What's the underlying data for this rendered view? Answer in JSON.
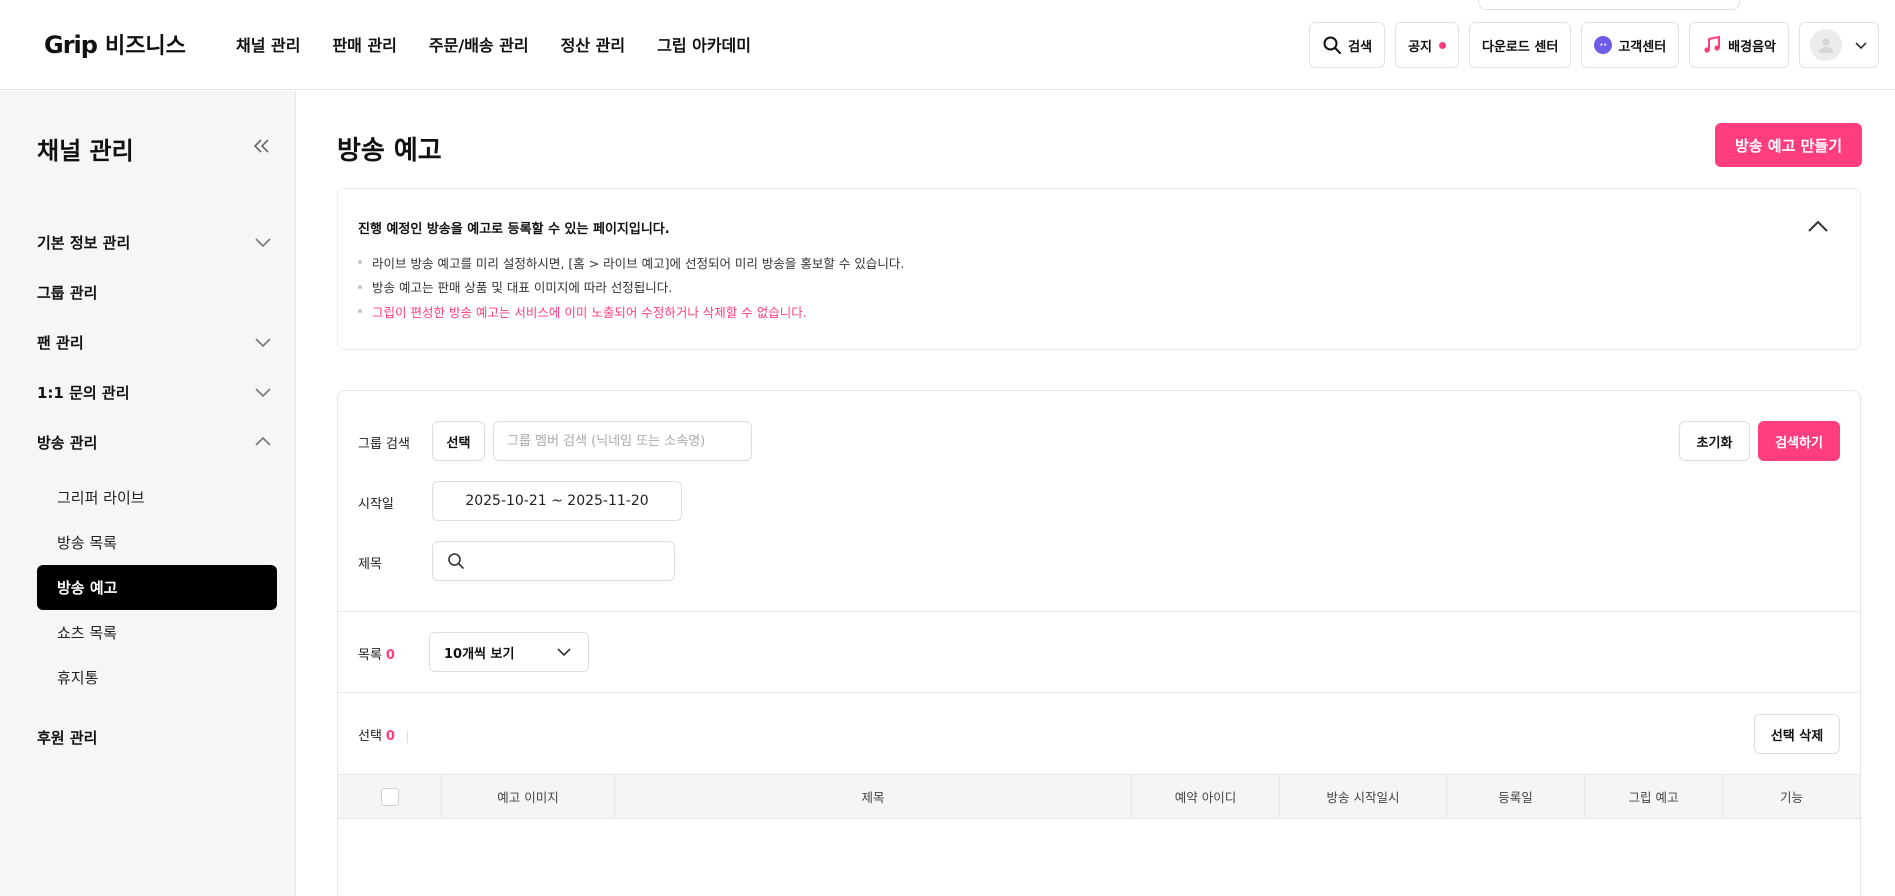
{
  "header": {
    "brand": "Grip",
    "brand_suffix": "비즈니스",
    "nav": [
      "채널 관리",
      "판매 관리",
      "주문/배송 관리",
      "정산 관리",
      "그립 아카데미"
    ],
    "search_label": "검색",
    "notice_label": "공지",
    "download_label": "다운로드 센터",
    "support_label": "고객센터",
    "bgm_label": "배경음악",
    "accent_color": "#ff3d7f"
  },
  "sidebar": {
    "title": "채널 관리",
    "items": {
      "basic": "기본 정보 관리",
      "group": "그룹 관리",
      "fan": "팬 관리",
      "inquiry": "1:1 문의 관리",
      "broadcast": "방송 관리",
      "sponsor": "후원 관리"
    },
    "sub_items": [
      "그리퍼 라이브",
      "방송 목록",
      "방송 예고",
      "쇼츠 목록",
      "휴지통"
    ],
    "active_sub": "방송 예고"
  },
  "main": {
    "title": "방송 예고",
    "create_button": "방송 예고 만들기",
    "notice": {
      "title": "진행 예정인 방송을 예고로 등록할 수 있는 페이지입니다.",
      "lines": [
        "라이브 방송 예고를 미리 설정하시면, [홈 > 라이브 예고]에 선정되어 미리 방송을 홍보할 수 있습니다.",
        "방송 예고는 판매 상품 및 대표 이미지에 따라 선정됩니다."
      ],
      "warning": "그립이 편성한 방송 예고는 서비스에 이미 노출되어 수정하거나 삭제할 수 없습니다."
    },
    "filters": {
      "group_label": "그룹 검색",
      "select_button": "선택",
      "group_placeholder": "그룹 멤버 검색 (닉네임 또는 소속명)",
      "start_label": "시작일",
      "date_range": "2025-10-21 ~ 2025-11-20",
      "title_label": "제목",
      "reset_button": "초기화",
      "search_button": "검색하기"
    },
    "list": {
      "count_label": "목록",
      "count": "0",
      "page_size": "10개씩 보기",
      "selected_label": "선택",
      "selected_count": "0",
      "delete_button": "선택 삭제"
    },
    "table": {
      "columns": [
        "예고 이미지",
        "제목",
        "예약 아이디",
        "방송 시작일시",
        "등록일",
        "그립 예고",
        "기능"
      ]
    }
  }
}
